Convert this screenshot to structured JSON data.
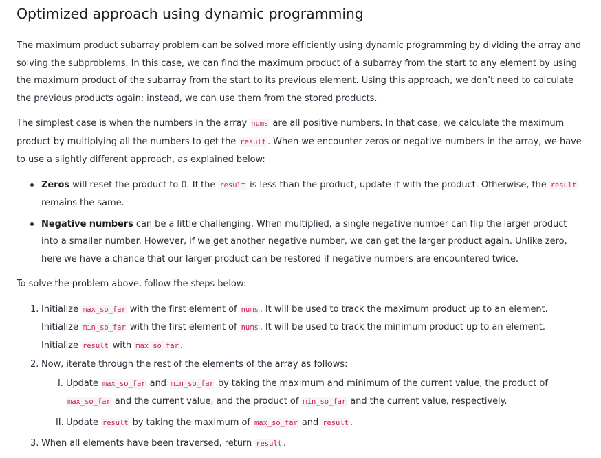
{
  "heading": "Optimized approach using dynamic programming",
  "intro": "The maximum product subarray problem can be solved more efficiently using dynamic programming by dividing the array and solving the subproblems. In this case, we can find the maximum product of a subarray from the start to any element by using the maximum product of the subarray from the start to its previous element. Using this approach, we don’t need to calculate the previous products again; instead, we can use them from the stored products.",
  "simplest": {
    "t1": "The simplest case is when the numbers in the array ",
    "c1": "nums",
    "t2": " are all positive numbers. In that case, we calculate the maximum product by multiplying all the numbers to get the ",
    "c2": "result",
    "t3": ". When we encounter zeros or negative numbers in the array, we have to use a slightly different approach, as explained below:"
  },
  "bullets": {
    "zeros": {
      "label": "Zeros",
      "t1": " will reset the product to ",
      "zero": "0",
      "t2": ". If the ",
      "c1": "result",
      "t3": " is less than the product, update it with the product. Otherwise, the ",
      "c2": "result",
      "t4": " remains the same."
    },
    "negatives": {
      "label": "Negative numbers",
      "t1": " can be a little challenging. When multiplied, a single negative number can flip the larger product into a smaller number. However, if we get another negative number, we can get the larger product again. Unlike zero, here we have a chance that our larger product can be restored if negative numbers are encountered twice."
    }
  },
  "steps_intro": "To solve the problem above, follow the steps below:",
  "steps": {
    "s1": {
      "num": "1.",
      "t1": "Initialize ",
      "c1": "max_so_far",
      "t2": " with the first element of ",
      "c2": "nums",
      "t3": ". It will be used to track the maximum product up to an element. Initialize ",
      "c3": "min_so_far",
      "t4": " with the first element of ",
      "c4": "nums",
      "t5": ". It will be used to track the minimum product up to an element. Initialize ",
      "c5": "result",
      "t6": " with ",
      "c6": "max_so_far",
      "t7": "."
    },
    "s2": {
      "num": "2.",
      "text": "Now, iterate through the rest of the elements of the array as follows:",
      "sub1": {
        "num": "I.",
        "t1": "Update ",
        "c1": "max_so_far",
        "t2": " and ",
        "c2": "min_so_far",
        "t3": " by taking the maximum and minimum of the current value, the product of ",
        "c3": "max_so_far",
        "t4": " and the current value, and the product of ",
        "c4": "min_so_far",
        "t5": " and the current value, respectively."
      },
      "sub2": {
        "num": "II.",
        "t1": "Update ",
        "c1": "result",
        "t2": " by taking the maximum of ",
        "c2": "max_so_far",
        "t3": " and ",
        "c3": "result",
        "t4": "."
      }
    },
    "s3": {
      "num": "3.",
      "t1": "When all elements have been traversed, return ",
      "c1": "result",
      "t2": "."
    }
  }
}
